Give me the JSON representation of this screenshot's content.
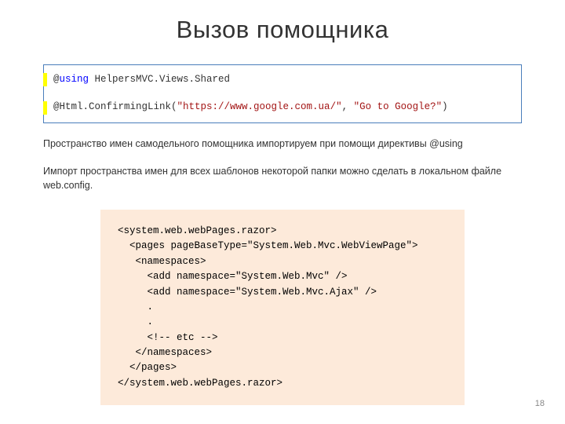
{
  "title": "Вызов помощника",
  "code1": {
    "line1_at": "@",
    "line1_kw": "using",
    "line1_rest": " HelpersMVC.Views.Shared",
    "line2_prefix": "@Html.ConfirmingLink(",
    "line2_str1": "\"https://www.google.com.ua/\"",
    "line2_sep": ", ",
    "line2_str2": "\"Go to Google?\"",
    "line2_end": ")"
  },
  "para1": "Пространство имен самодельного помощника импортируем при помощи директивы @using",
  "para2": "Импорт пространства имен для всех шаблонов некоторой папки можно сделать в локальном файле web.config.",
  "code2": {
    "l1": "<system.web.webPages.razor>",
    "l2": "  <pages pageBaseType=\"System.Web.Mvc.WebViewPage\">",
    "l3": "   <namespaces>",
    "l4": "     <add namespace=\"System.Web.Mvc\" />",
    "l5": "     <add namespace=\"System.Web.Mvc.Ajax\" />",
    "l6": "     .",
    "l7": "     .",
    "l8": "     <!-- etc -->",
    "l9": "   </namespaces>",
    "l10": "  </pages>",
    "l11": "</system.web.webPages.razor>"
  },
  "page_number": "18"
}
